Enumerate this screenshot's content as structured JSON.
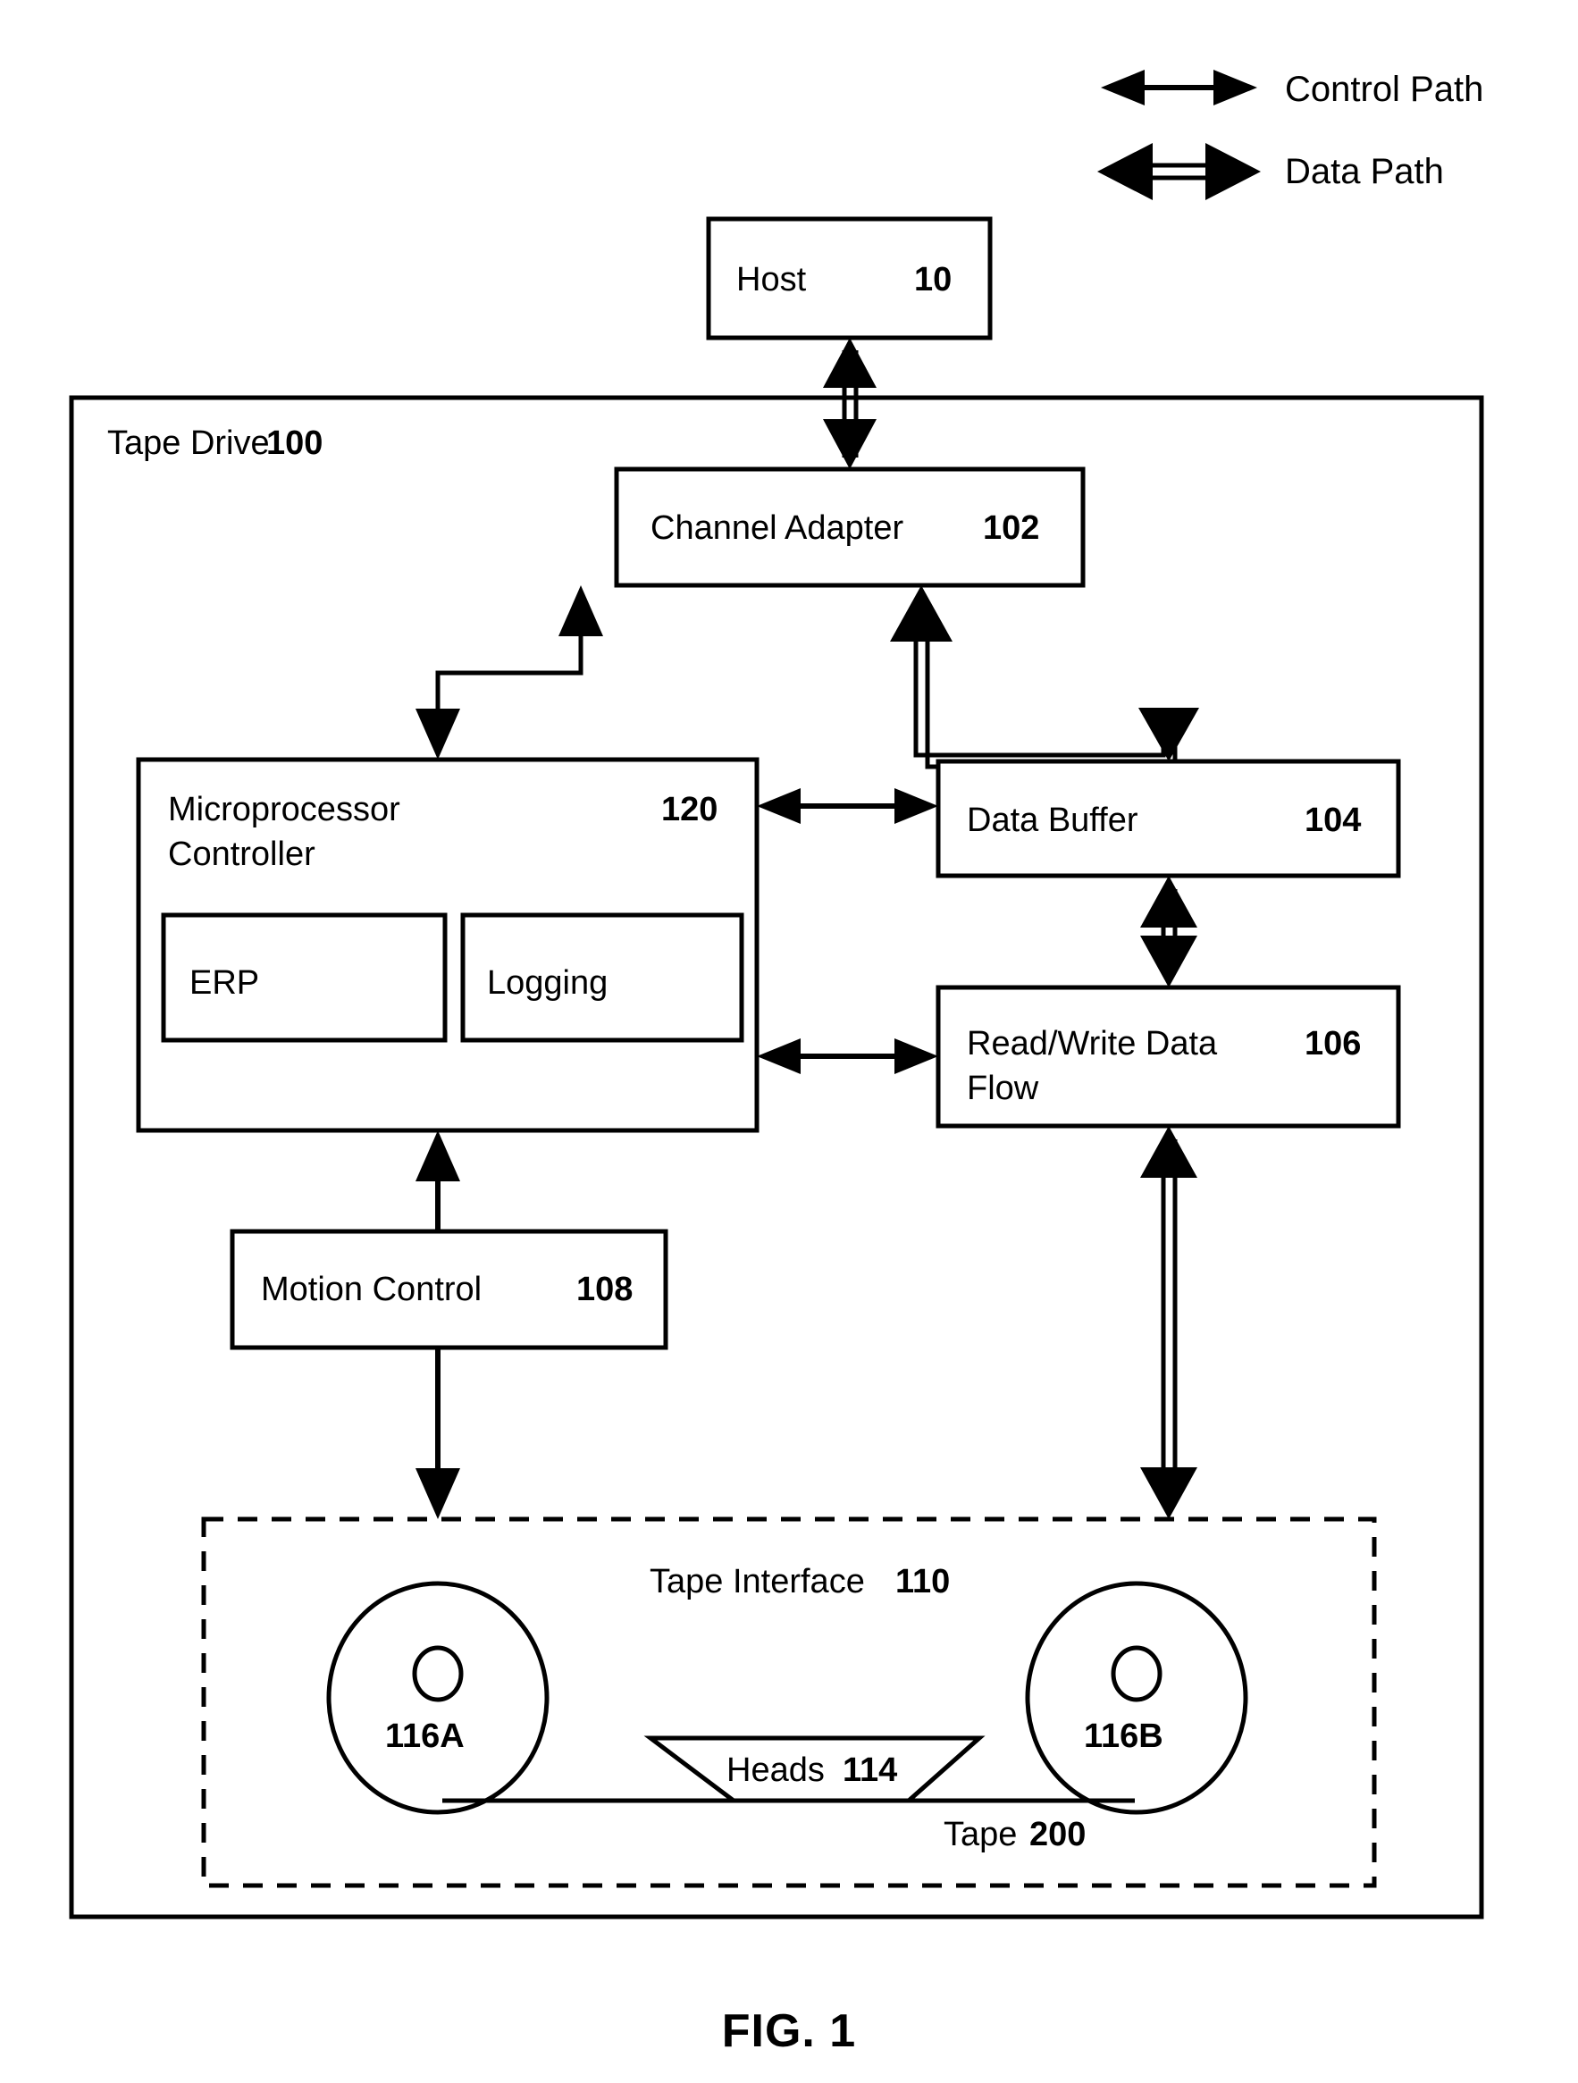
{
  "figure": {
    "caption": "FIG. 1"
  },
  "legend": {
    "items": [
      {
        "label": "Control Path",
        "style": "single-line-double-arrow"
      },
      {
        "label": "Data Path",
        "style": "double-line-double-arrow"
      }
    ]
  },
  "blocks": {
    "host": {
      "label": "Host",
      "ref": "10"
    },
    "tape_drive": {
      "label": "Tape Drive",
      "ref": "100"
    },
    "channel_adapter": {
      "label": "Channel Adapter",
      "ref": "102"
    },
    "microprocessor": {
      "label_line1": "Microprocessor",
      "label_line2": "Controller",
      "ref": "120"
    },
    "erp": {
      "label": "ERP"
    },
    "logging": {
      "label": "Logging"
    },
    "data_buffer": {
      "label": "Data Buffer",
      "ref": "104"
    },
    "read_write": {
      "label_line1": "Read/Write Data",
      "label_line2": "Flow",
      "ref": "106"
    },
    "motion_control": {
      "label": "Motion Control",
      "ref": "108"
    },
    "tape_interface": {
      "label": "Tape Interface",
      "ref": "110"
    },
    "heads": {
      "label": "Heads",
      "ref": "114"
    },
    "reel_a": {
      "ref": "116A"
    },
    "reel_b": {
      "ref": "116B"
    },
    "tape": {
      "label": "Tape",
      "ref": "200"
    }
  },
  "connections": [
    {
      "from": "host",
      "to": "channel_adapter",
      "kind": "Data Path",
      "arrows": "both"
    },
    {
      "from": "channel_adapter",
      "to": "microprocessor",
      "kind": "Control Path",
      "arrows": "both"
    },
    {
      "from": "channel_adapter",
      "to": "data_buffer",
      "kind": "Data Path",
      "arrows": "both"
    },
    {
      "from": "microprocessor",
      "to": "data_buffer",
      "kind": "Control Path",
      "arrows": "both"
    },
    {
      "from": "microprocessor",
      "to": "read_write",
      "kind": "Control Path",
      "arrows": "both"
    },
    {
      "from": "data_buffer",
      "to": "read_write",
      "kind": "Data Path",
      "arrows": "both"
    },
    {
      "from": "read_write",
      "to": "tape_interface",
      "kind": "Data Path",
      "arrows": "both"
    },
    {
      "from": "motion_control",
      "to": "microprocessor",
      "kind": "Control Path",
      "arrows": "both"
    },
    {
      "from": "motion_control",
      "to": "tape_interface",
      "kind": "Control Path",
      "arrows": "both"
    }
  ],
  "colors": {
    "stroke": "#000000",
    "background": "#ffffff"
  }
}
